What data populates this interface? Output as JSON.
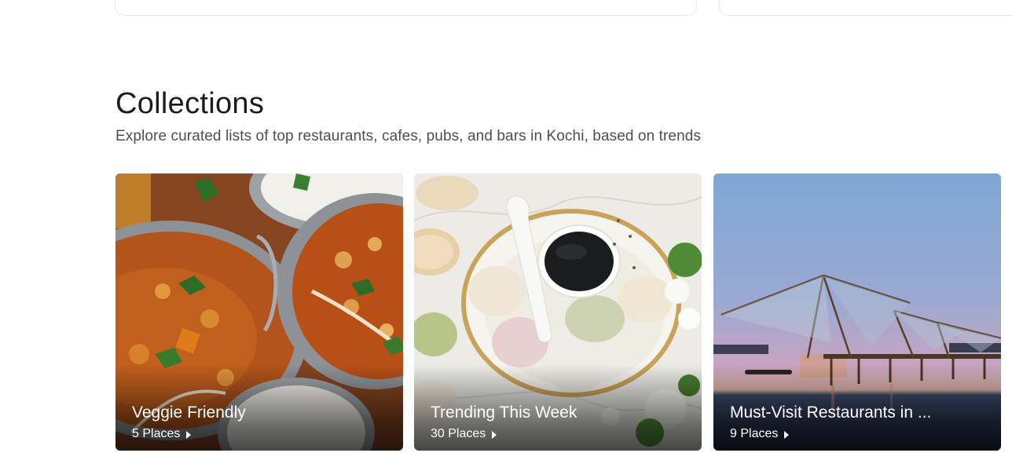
{
  "section": {
    "title": "Collections",
    "subtitle": "Explore curated lists of top restaurants, cafes, pubs, and bars in Kochi, based on trends"
  },
  "collections": [
    {
      "name": "Veggie Friendly",
      "places": "5 Places",
      "image": "vegetarian-curry-bowls"
    },
    {
      "name": "Trending This Week",
      "places": "30 Places",
      "image": "coffee-and-macarons"
    },
    {
      "name": "Must-Visit Restaurants in ...",
      "places": "9 Places",
      "image": "chinese-fishing-nets-sunset"
    }
  ],
  "icons": {
    "caret": "caret-right-icon"
  }
}
